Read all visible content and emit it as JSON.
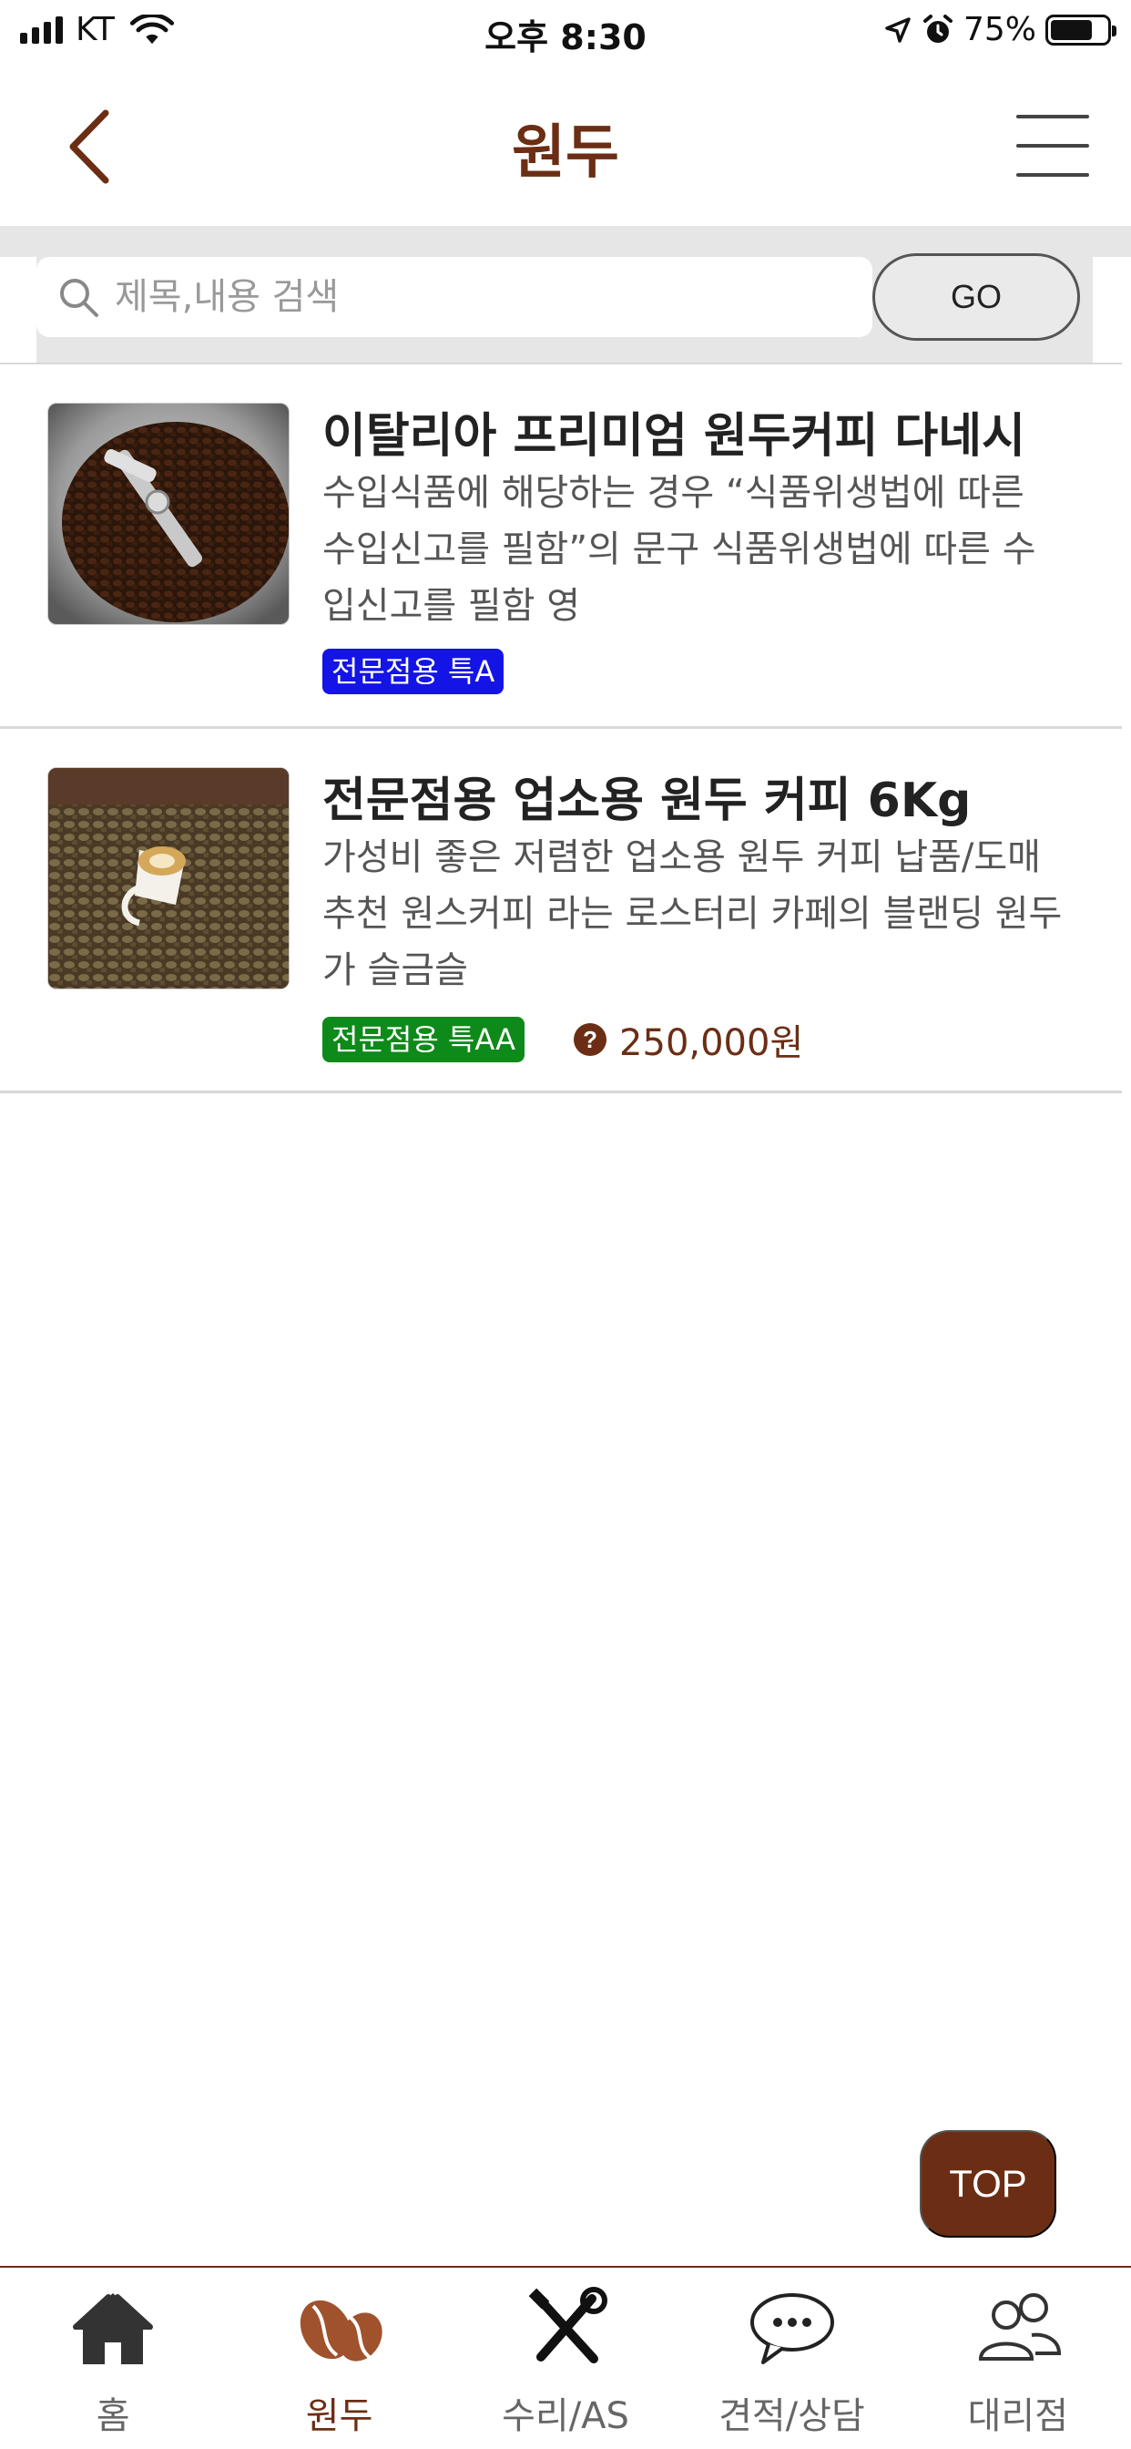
{
  "status_bar": {
    "carrier": "KT",
    "time": "오후 8:30",
    "battery": "75%",
    "battery_level": 0.75
  },
  "header": {
    "title": "원두",
    "back_icon": "chevron-left-icon",
    "menu_icon": "hamburger-menu-icon"
  },
  "search": {
    "placeholder": "제목,내용 검색",
    "value": "",
    "go_label": "GO"
  },
  "products": [
    {
      "title": "이탈리아 프리미엄 원두커피 다네시",
      "description": "수입식품에 해당하는 경우 “식품위생법에 따른 수입신고를 필함”의 문구 식품위생법에 따른 수입신고를 필함 영",
      "badge": "전문점용 특A",
      "badge_color": "#1414e6",
      "image": "coffee-roaster-drum",
      "price": ""
    },
    {
      "title": "전문점용 업소용 원두 커피 6Kg",
      "description": "가성비 좋은 저렴한 업소용 원두 커피 납품/도매 추천 원스커피 라는 로스터리 카페의 블랜딩 원두가 슬금슬",
      "badge": "전문점용 특AA",
      "badge_color": "#0e8a1a",
      "image": "espresso-cup-on-beans",
      "price": "250,000원",
      "price_icon": "?"
    }
  ],
  "top_button": "TOP",
  "bottom_nav": [
    {
      "label": "홈",
      "icon": "home-icon",
      "active": false
    },
    {
      "label": "원두",
      "icon": "coffee-bean-icon",
      "active": true
    },
    {
      "label": "수리/AS",
      "icon": "tools-icon",
      "active": false
    },
    {
      "label": "견적/상담",
      "icon": "chat-bubbles-icon",
      "active": false
    },
    {
      "label": "대리점",
      "icon": "people-icon",
      "active": false
    }
  ],
  "colors": {
    "brand": "#6b2e14",
    "divider": "#d8d8d8",
    "search_band": "#e6e6e6"
  }
}
